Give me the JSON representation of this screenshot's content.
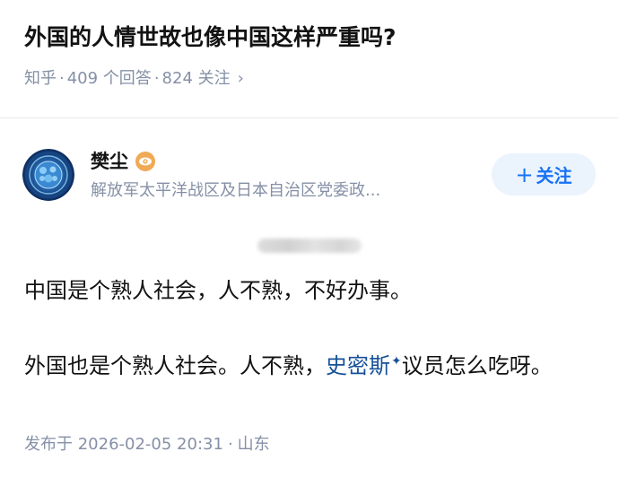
{
  "question": {
    "title": "外国的人情世故也像中国这样严重吗?",
    "source": "知乎",
    "answers_count": "409 个回答",
    "followers_count": "824 关注",
    "separator": "·",
    "chevron": "›"
  },
  "author": {
    "name": "樊尘",
    "headline": "解放军太平洋战区及日本自治区党委政...",
    "follow_label": "关注",
    "follow_plus": "+",
    "avatar_icon": "blue-globe-avatar",
    "badge_icon": "eye-badge-icon",
    "badge_color": "#f0a955"
  },
  "answer": {
    "paragraph1": "中国是个熟人社会，人不熟，不好办事。",
    "paragraph2_before": "外国也是个熟人社会。人不熟，",
    "paragraph2_link": "史密斯",
    "paragraph2_link_mark": "✦",
    "paragraph2_after": "议员怎么吃呀。",
    "link_color": "#175199"
  },
  "publish": {
    "label": "发布于 2026-02-05 20:31",
    "separator": "·",
    "location": "山东"
  },
  "colors": {
    "accent": "#1772f6",
    "follow_bg": "#ebf3fd",
    "meta_gray": "#8590a6",
    "title": "#121212"
  }
}
